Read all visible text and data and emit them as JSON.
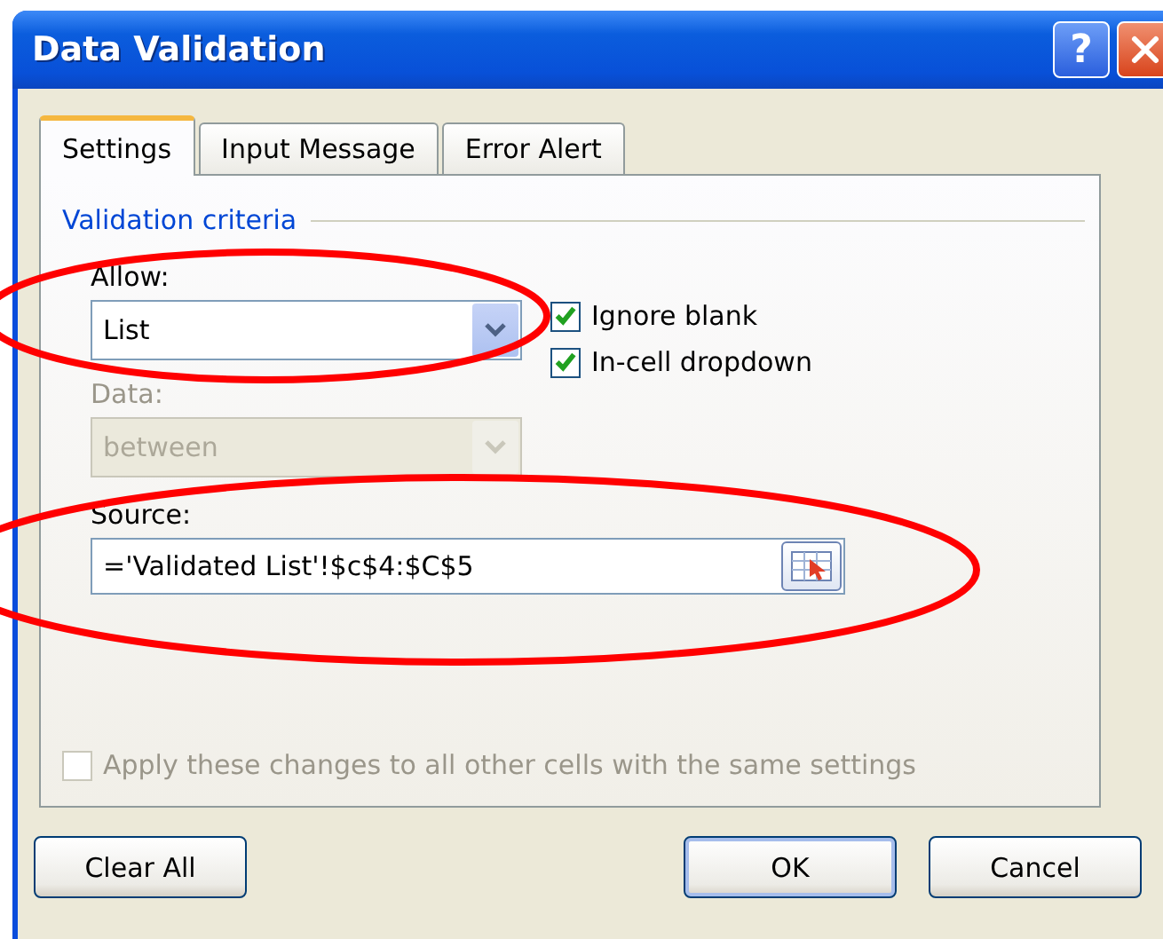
{
  "window": {
    "title": "Data Validation",
    "buttons": [
      {
        "kind": "help",
        "label": "?"
      },
      {
        "kind": "close"
      }
    ]
  },
  "tabs": [
    {
      "label": "Settings",
      "selected": true
    },
    {
      "label": "Input Message",
      "selected": false
    },
    {
      "label": "Error Alert",
      "selected": false
    }
  ],
  "group": {
    "title": "Validation criteria"
  },
  "allow": {
    "label": "Allow:",
    "value": "List",
    "disabled": false
  },
  "options": [
    {
      "label": "Ignore blank",
      "checked": true
    },
    {
      "label": "In-cell dropdown",
      "checked": true
    }
  ],
  "data": {
    "label": "Data:",
    "value": "between",
    "disabled": true
  },
  "source": {
    "label": "Source:",
    "value": "='Validated List'!$c$4:$C$5"
  },
  "apply_all": {
    "label": "Apply these changes to all other cells with the same settings",
    "checked": false,
    "disabled": true
  },
  "buttons": [
    {
      "label": "Clear All",
      "kind": "left"
    },
    {
      "label": "OK",
      "kind": "default"
    },
    {
      "label": "Cancel",
      "kind": "normal"
    }
  ],
  "annotations": [
    {
      "kind": "ellipse",
      "color": "#ff0000"
    },
    {
      "kind": "ellipse",
      "color": "#ff0000"
    }
  ]
}
